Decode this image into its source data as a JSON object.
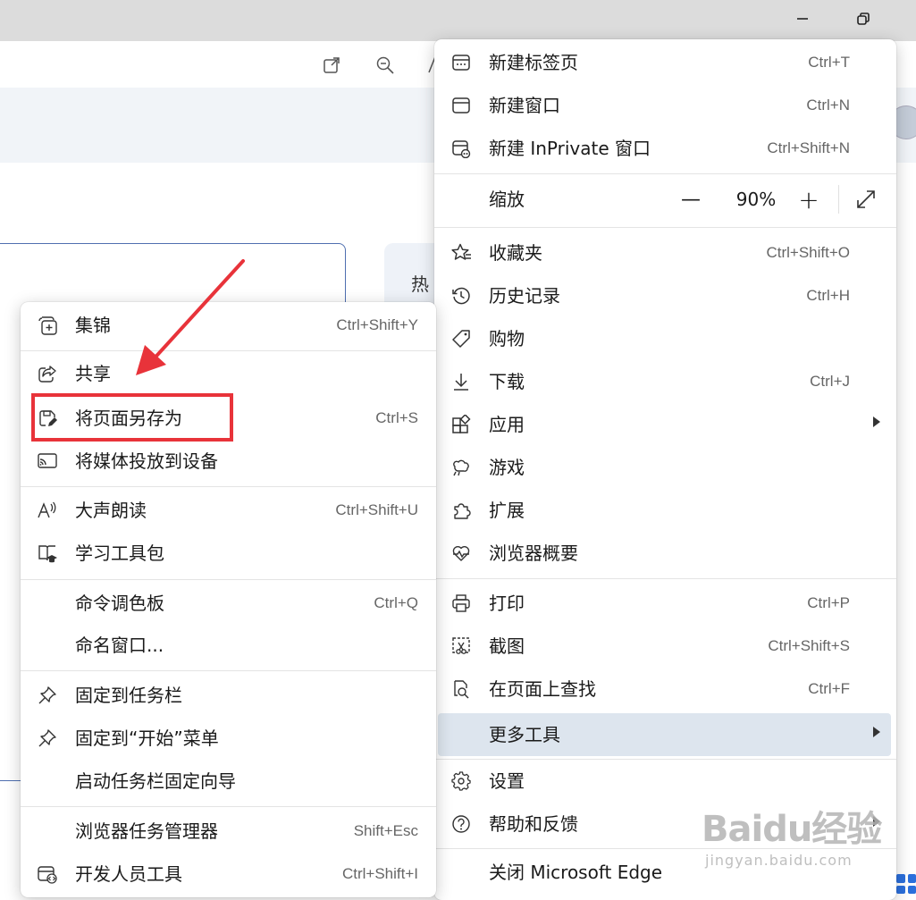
{
  "main_menu": {
    "new_tab": {
      "label": "新建标签页",
      "shortcut": "Ctrl+T"
    },
    "new_window": {
      "label": "新建窗口",
      "shortcut": "Ctrl+N"
    },
    "new_inprivate": {
      "label": "新建 InPrivate 窗口",
      "shortcut": "Ctrl+Shift+N"
    },
    "zoom": {
      "label": "缩放",
      "minus": "—",
      "value": "90%",
      "plus": "+"
    },
    "favorites": {
      "label": "收藏夹",
      "shortcut": "Ctrl+Shift+O"
    },
    "history": {
      "label": "历史记录",
      "shortcut": "Ctrl+H"
    },
    "shopping": {
      "label": "购物"
    },
    "downloads": {
      "label": "下载",
      "shortcut": "Ctrl+J"
    },
    "apps": {
      "label": "应用"
    },
    "games": {
      "label": "游戏"
    },
    "extensions": {
      "label": "扩展"
    },
    "browser_essentials": {
      "label": "浏览器概要"
    },
    "print": {
      "label": "打印",
      "shortcut": "Ctrl+P"
    },
    "screenshot": {
      "label": "截图",
      "shortcut": "Ctrl+Shift+S"
    },
    "find_on_page": {
      "label": "在页面上查找",
      "shortcut": "Ctrl+F"
    },
    "more_tools": {
      "label": "更多工具"
    },
    "settings": {
      "label": "设置"
    },
    "help_feedback": {
      "label": "帮助和反馈"
    },
    "close_edge": {
      "label": "关闭 Microsoft Edge"
    }
  },
  "sub_menu": {
    "collections": {
      "label": "集锦",
      "shortcut": "Ctrl+Shift+Y"
    },
    "share": {
      "label": "共享"
    },
    "save_page_as": {
      "label": "将页面另存为",
      "shortcut": "Ctrl+S"
    },
    "cast_media": {
      "label": "将媒体投放到设备"
    },
    "read_aloud": {
      "label": "大声朗读",
      "shortcut": "Ctrl+Shift+U"
    },
    "learning_toolkit": {
      "label": "学习工具包"
    },
    "command_palette": {
      "label": "命令调色板",
      "shortcut": "Ctrl+Q"
    },
    "name_window": {
      "label": "命名窗口..."
    },
    "pin_taskbar": {
      "label": "固定到任务栏"
    },
    "pin_start": {
      "label": "固定到“开始”菜单"
    },
    "taskbar_wizard": {
      "label": "启动任务栏固定向导"
    },
    "task_manager": {
      "label": "浏览器任务管理器",
      "shortcut": "Shift+Esc"
    },
    "dev_tools": {
      "label": "开发人员工具",
      "shortcut": "Ctrl+Shift+I"
    }
  },
  "background": {
    "hot_label": "热"
  },
  "watermark": {
    "logo": "Baidu经验",
    "sub": "jingyan.baidu.com"
  },
  "colors": {
    "highlight": "#dde5ee",
    "annotation": "#e8333a",
    "accent": "#2b6fdc"
  }
}
